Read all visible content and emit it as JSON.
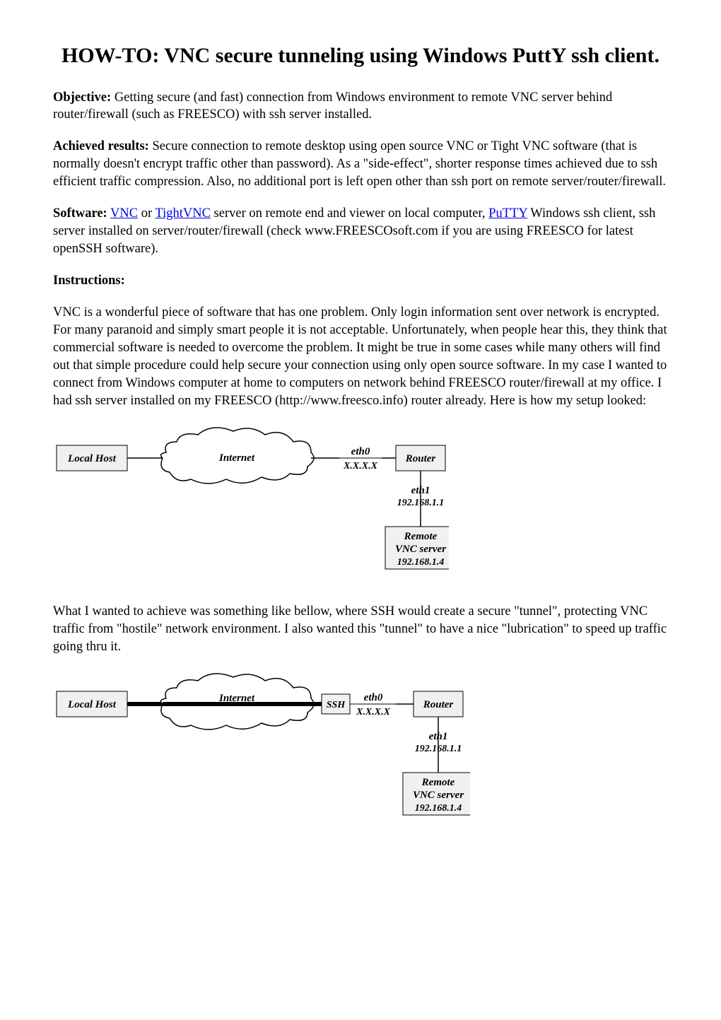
{
  "title": "HOW-TO: VNC secure tunneling using Windows PuttY ssh client.",
  "objective": {
    "label": "Objective:",
    "text": " Getting secure (and fast) connection from Windows environment to remote VNC server behind router/firewall (such as FREESCO) with ssh server installed."
  },
  "achieved": {
    "label": "Achieved results:",
    "text": " Secure connection to remote desktop using open source VNC or Tight VNC software (that is normally doesn't encrypt traffic other than password). As a \"side-effect\", shorter response times achieved due to ssh efficient traffic compression. Also, no additional port is left open other than ssh port on remote server/router/firewall."
  },
  "software": {
    "label": "Software:",
    "pre": " ",
    "link_vnc": "VNC",
    "mid1": " or ",
    "link_tightvnc": "TightVNC",
    "mid2": " server on remote end and viewer on local computer, ",
    "link_putty": "PuTTY",
    "post": " Windows ssh client, ssh server installed on server/router/firewall (check www.FREESCOsoft.com if you are using FREESCO for latest openSSH software)."
  },
  "instructions_label": "Instructions:",
  "body_para1": "VNC is a wonderful piece of software that has one problem. Only login information sent over network is encrypted. For many paranoid and simply smart people it is not acceptable. Unfortunately, when people hear this, they think that commercial software is needed to overcome the problem. It might be true in some cases while many others will find out that simple procedure could help secure your connection using only open source software. In my case I wanted to connect from Windows computer at home to computers on network behind FREESCO router/firewall at my office. I had ssh server installed on my FREESCO (http://www.freesco.info) router already. Here is how my setup looked:",
  "body_para2": "What I wanted to achieve was something like bellow, where SSH would create a secure \"tunnel\", protecting VNC traffic from \"hostile\" network environment. I also wanted this \"tunnel\" to have a nice \"lubrication\" to speed up traffic going thru it.",
  "diagram1": {
    "local_host": "Local Host",
    "internet": "Internet",
    "eth0": "eth0",
    "eth0_ip": "X.X.X.X",
    "router": "Router",
    "eth1": "eth1",
    "eth1_ip": "192.168.1.1",
    "remote": "Remote",
    "vnc_server": "VNC server",
    "vnc_ip": "192.168.1.4"
  },
  "diagram2": {
    "local_host": "Local Host",
    "internet": "Internet",
    "ssh": "SSH",
    "eth0": "eth0",
    "eth0_ip": "X.X.X.X",
    "router": "Router",
    "eth1": "eth1",
    "eth1_ip": "192.168.1.1",
    "remote": "Remote",
    "vnc_server": "VNC server",
    "vnc_ip": "192.168.1.4"
  }
}
